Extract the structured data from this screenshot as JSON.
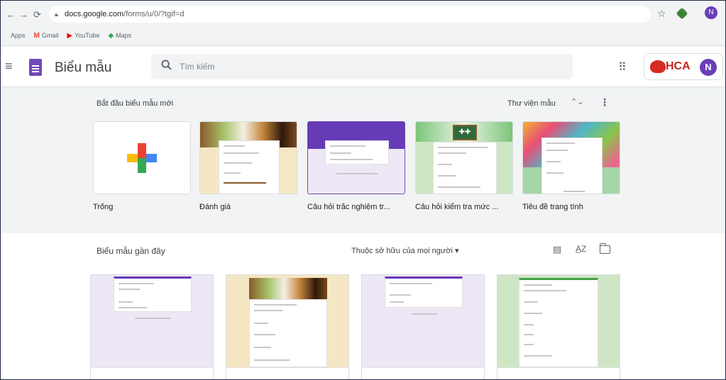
{
  "browser": {
    "url_host": "docs.google.com",
    "url_path": "/forms/u/0/?tgif=d",
    "bookmarks": [
      {
        "label": "Apps",
        "icon": "apps-grid-icon",
        "color": "#5f6368"
      },
      {
        "label": "Gmail",
        "icon": "gmail-icon",
        "color": "#ea4335"
      },
      {
        "label": "YouTube",
        "icon": "youtube-icon",
        "color": "#ff0000"
      },
      {
        "label": "Maps",
        "icon": "maps-icon",
        "color": "#34a853"
      }
    ],
    "profile_initial": "N"
  },
  "header": {
    "app_title": "Biểu mẫu",
    "search_placeholder": "Tìm kiếm",
    "org_name": "HCA",
    "account_initial": "N"
  },
  "templates": {
    "section_title": "Bắt đầu biểu mẫu mới",
    "gallery_label": "Thư viện mẫu",
    "items": [
      {
        "label": "Trống"
      },
      {
        "label": "Đánh giá"
      },
      {
        "label": "Câu hỏi trắc nghiệm tr..."
      },
      {
        "label": "Câu hỏi kiểm tra mức ..."
      },
      {
        "label": "Tiêu đề trang tính"
      }
    ]
  },
  "recent": {
    "section_title": "Biểu mẫu gần đây",
    "owner_filter": "Thuộc sở hữu của mọi người",
    "docs": [
      {
        "theme": "lavender"
      },
      {
        "theme": "food"
      },
      {
        "theme": "lavender"
      },
      {
        "theme": "green"
      }
    ]
  },
  "colors": {
    "forms_purple": "#673ab7",
    "brand_red": "#c5261e",
    "chrome_bg": "#f1f3f4"
  }
}
